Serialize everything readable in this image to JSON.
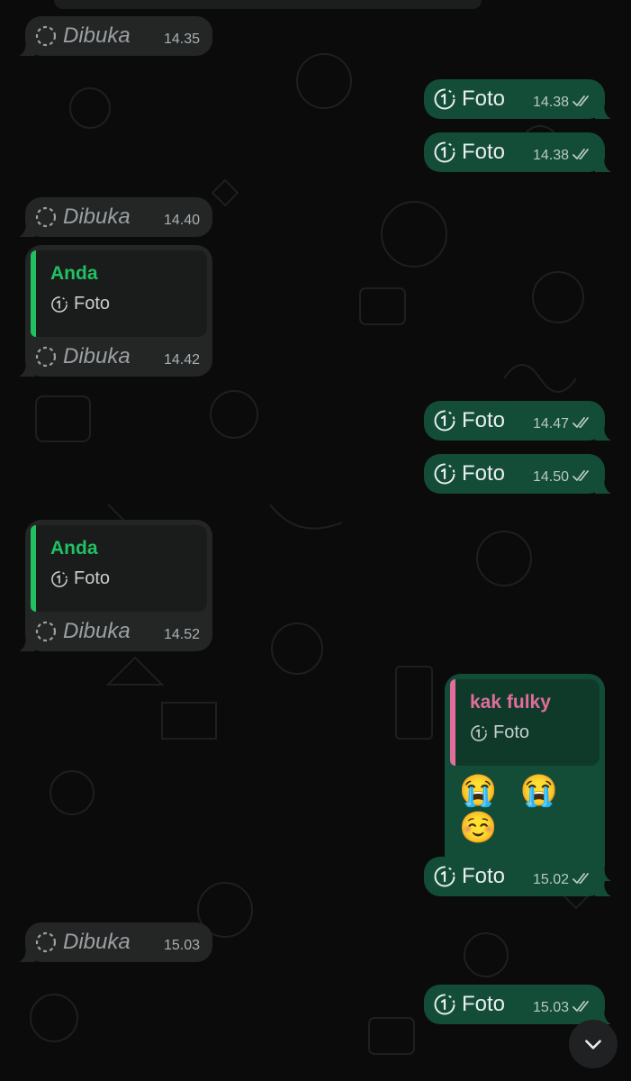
{
  "colors": {
    "background": "#0b0b0b",
    "incoming_bubble": "#242626",
    "outgoing_bubble": "#134d37",
    "quote_own_name": "#21c063",
    "quote_contact_name": "#e26d9c"
  },
  "messages": [
    {
      "dir": "in",
      "kind": "viewed",
      "text": "Dibuka",
      "time": "14.35"
    },
    {
      "dir": "out",
      "kind": "view_once_photo",
      "text": "Foto",
      "time": "14.38"
    },
    {
      "dir": "out",
      "kind": "view_once_photo",
      "text": "Foto",
      "time": "14.38"
    },
    {
      "dir": "in",
      "kind": "viewed",
      "text": "Dibuka",
      "time": "14.40"
    },
    {
      "dir": "in",
      "kind": "reply_viewed",
      "quote_name": "Anda",
      "quote_text": "Foto",
      "text": "Dibuka",
      "time": "14.42"
    },
    {
      "dir": "out",
      "kind": "view_once_photo",
      "text": "Foto",
      "time": "14.47"
    },
    {
      "dir": "out",
      "kind": "view_once_photo",
      "text": "Foto",
      "time": "14.50"
    },
    {
      "dir": "in",
      "kind": "reply_viewed",
      "quote_name": "Anda",
      "quote_text": "Foto",
      "text": "Dibuka",
      "time": "14.52"
    },
    {
      "dir": "out",
      "kind": "reply_emoji",
      "quote_name": "kak fulky",
      "quote_text": "Foto",
      "text": "😭 😭 ☺️",
      "time": "15.02"
    },
    {
      "dir": "out",
      "kind": "view_once_photo",
      "text": "Foto",
      "time": "15.02"
    },
    {
      "dir": "in",
      "kind": "viewed",
      "text": "Dibuka",
      "time": "15.03"
    },
    {
      "dir": "out",
      "kind": "view_once_photo",
      "text": "Foto",
      "time": "15.03"
    }
  ],
  "icons": {
    "view_once": "view-once-icon",
    "opened": "opened-circle-icon",
    "read_ticks": "double-check-icon",
    "scroll_down": "chevron-down-icon"
  }
}
